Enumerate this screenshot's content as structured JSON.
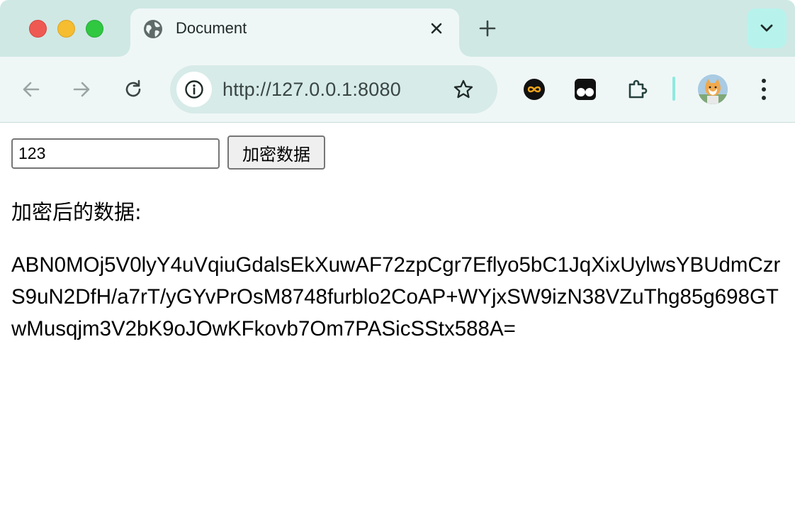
{
  "tab": {
    "title": "Document",
    "icon": "globe-icon"
  },
  "toolbar": {
    "url": "http://127.0.0.1:8080"
  },
  "page": {
    "input_value": "123",
    "encrypt_button_label": "加密数据",
    "result_label": "加密后的数据:",
    "result_value": "ABN0MOj5V0lyY4uVqiuGdalsEkXuwAF72zpCgr7Eflyo5bC1JqXixUylwsYBUdmCzrS9uN2DfH/a7rT/yGYvPrOsM8748furblo2CoAP+WYjxSW9izN38VZuThg85g698GTwMusqjm3V2bK9oJOwKFkovb7Om7PASicSStx588A="
  },
  "colors": {
    "tabstrip_bg": "#cfe8e4",
    "toolbar_bg": "#eff7f6",
    "accent": "#8fe9e0"
  }
}
